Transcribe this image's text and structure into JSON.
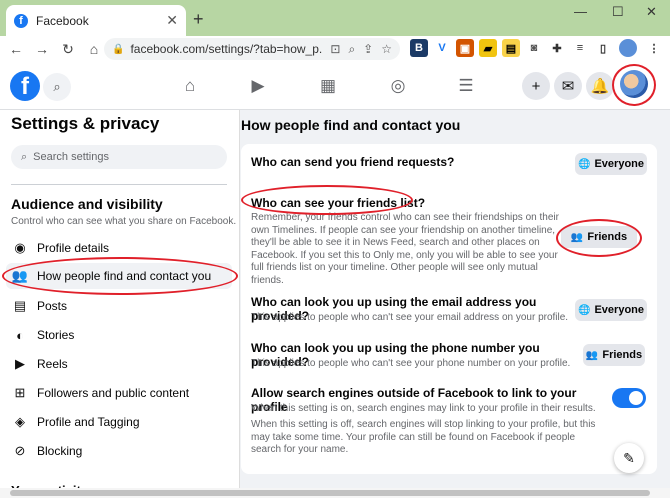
{
  "browser": {
    "tab_title": "Facebook",
    "tab_favicon": "f",
    "tab_close": "✕",
    "new_tab": "+",
    "window_controls": [
      "—",
      "☐",
      "✕"
    ],
    "nav_icons": [
      "back-icon",
      "forward-icon",
      "reload-icon",
      "home-icon"
    ],
    "url": "facebook.com/settings/?tab=how_p..."
  },
  "fb_header": {
    "logo": "f",
    "nav_icons": [
      "home-icon",
      "watch-icon",
      "marketplace-icon",
      "groups-icon",
      "menu-icon"
    ],
    "right_buttons": [
      "create-icon",
      "messenger-icon",
      "notifications-icon"
    ]
  },
  "sidebar": {
    "title": "Settings & privacy",
    "search_placeholder": "Search settings",
    "section_title": "Audience and visibility",
    "section_subtitle": "Control who can see what you share on Facebook.",
    "items": [
      {
        "label": "Profile details",
        "icon": "profile-icon",
        "active": false
      },
      {
        "label": "How people find and contact you",
        "icon": "people-icon",
        "active": true
      },
      {
        "label": "Posts",
        "icon": "posts-icon",
        "active": false
      },
      {
        "label": "Stories",
        "icon": "stories-icon",
        "active": false
      },
      {
        "label": "Reels",
        "icon": "reels-icon",
        "active": false
      },
      {
        "label": "Followers and public content",
        "icon": "followers-icon",
        "active": false
      },
      {
        "label": "Profile and Tagging",
        "icon": "tag-icon",
        "active": false
      },
      {
        "label": "Blocking",
        "icon": "block-icon",
        "active": false
      }
    ],
    "bottom_label": "Your activity"
  },
  "main": {
    "title": "How people find and contact you",
    "rows": [
      {
        "question": "Who can send you friend requests?",
        "description": "",
        "button": "Everyone",
        "button_icon": "globe-icon"
      },
      {
        "question": "Who can see your friends list?",
        "description": "Remember, your friends control who can see their friendships on their own Timelines. If people can see your friendship on another timeline, they'll be able to see it in News Feed, search and other places on Facebook. If you set this to Only me, only you will be able to see your full friends list on your timeline. Other people will see only mutual friends.",
        "button": "Friends",
        "button_icon": "friends-icon"
      },
      {
        "question": "Who can look you up using the email address you provided?",
        "description": "This applies to people who can't see your email address on your profile.",
        "button": "Everyone",
        "button_icon": "globe-icon"
      },
      {
        "question": "Who can look you up using the phone number you provided?",
        "description": "This applies to people who can't see your phone number on your profile.",
        "button": "Friends",
        "button_icon": "friends-icon"
      },
      {
        "question": "Allow search engines outside of Facebook to link to your profile",
        "description": "When this setting is on, search engines may link to your profile in their results.",
        "description2": "When this setting is off, search engines will stop linking to your profile, but this may take some time. Your profile can still be found on Facebook if people search for your name.",
        "toggle": true
      }
    ]
  },
  "colors": {
    "brand_blue": "#1877f2",
    "annotation_red": "#e0202a",
    "tab_strip_green": "#b7d6a3"
  }
}
